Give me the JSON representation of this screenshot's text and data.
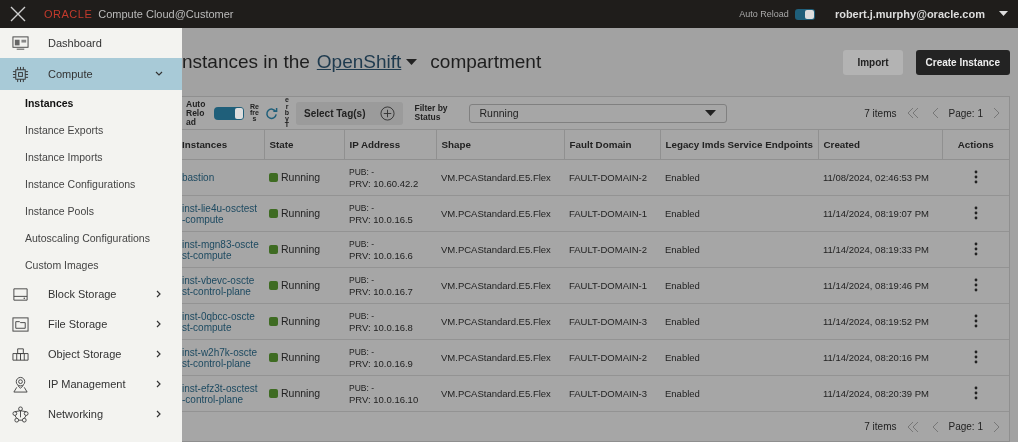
{
  "header": {
    "logo": "ORACLE",
    "product": "Compute Cloud@Customer",
    "auto_reload": {
      "label": "Auto Reload",
      "on": true
    },
    "user": "robert.j.murphy@oracle.com"
  },
  "sidebar": {
    "items": [
      {
        "kind": "link",
        "label": "Dashboard",
        "selected": false
      },
      {
        "kind": "group",
        "label": "Compute",
        "expanded": true,
        "selected": true,
        "children": [
          {
            "label": "Instances",
            "selected": true
          },
          {
            "label": "Instance Exports",
            "selected": false
          },
          {
            "label": "Instance Imports",
            "selected": false
          },
          {
            "label": "Instance Configurations",
            "selected": false
          },
          {
            "label": "Instance Pools",
            "selected": false
          },
          {
            "label": "Autoscaling Configurations",
            "selected": false
          },
          {
            "label": "Custom Images",
            "selected": false
          }
        ]
      },
      {
        "kind": "group",
        "label": "Block Storage",
        "expanded": false,
        "selected": false
      },
      {
        "kind": "group",
        "label": "File Storage",
        "expanded": false,
        "selected": false
      },
      {
        "kind": "group",
        "label": "Object Storage",
        "expanded": false,
        "selected": false
      },
      {
        "kind": "group",
        "label": "IP Management",
        "expanded": false,
        "selected": false
      },
      {
        "kind": "group",
        "label": "Networking",
        "expanded": false,
        "selected": false
      }
    ]
  },
  "page": {
    "title_start": "nstances in the",
    "compartment": "OpenShift",
    "title_end": "compartment",
    "buttons": [
      {
        "label": "Import",
        "kind": "secondary"
      },
      {
        "label": "Create Instance",
        "kind": "primary"
      }
    ]
  },
  "toolbar": {
    "auto_reload": {
      "label": "Auto Relo ad",
      "on": true
    },
    "refresh_label": "Refres",
    "tag_label": "erbyT",
    "select_tags": "Select Tag(s)",
    "filter_label": "Filter by Status",
    "filter_value": "Running"
  },
  "pager_top": {
    "count": "7 items",
    "page": "Page: 1"
  },
  "table": {
    "columns": [
      "Instances",
      "State",
      "IP Address",
      "Shape",
      "Fault Domain",
      "Legacy Imds Service Endpoints",
      "Created",
      "Actions"
    ],
    "rows": [
      {
        "name": "bastion",
        "state": {
          "label": "Running",
          "color": "#3e6b22"
        },
        "pub": "PUB: -",
        "prv": "PRV: 10.60.42.2",
        "shape": "VM.PCAStandard.E5.Flex",
        "fault_domain": "FAULT-DOMAIN-2",
        "legacy": "Enabled",
        "created": "11/08/2024, 02:46:53 PM"
      },
      {
        "name": "inst-lie4u-osctest-compute",
        "state": {
          "label": "Running",
          "color": "#3e6b22"
        },
        "pub": "PUB: -",
        "prv": "PRV: 10.0.16.5",
        "shape": "VM.PCAStandard.E5.Flex",
        "fault_domain": "FAULT-DOMAIN-1",
        "legacy": "Enabled",
        "created": "11/14/2024, 08:19:07 PM"
      },
      {
        "name": "inst-mgn83-osctest-compute",
        "state": {
          "label": "Running",
          "color": "#3e6b22"
        },
        "pub": "PUB: -",
        "prv": "PRV: 10.0.16.6",
        "shape": "VM.PCAStandard.E5.Flex",
        "fault_domain": "FAULT-DOMAIN-2",
        "legacy": "Enabled",
        "created": "11/14/2024, 08:19:33 PM"
      },
      {
        "name": "inst-vbevc-osctest-control-plane",
        "state": {
          "label": "Running",
          "color": "#3e6b22"
        },
        "pub": "PUB: -",
        "prv": "PRV: 10.0.16.7",
        "shape": "VM.PCAStandard.E5.Flex",
        "fault_domain": "FAULT-DOMAIN-1",
        "legacy": "Enabled",
        "created": "11/14/2024, 08:19:46 PM"
      },
      {
        "name": "inst-0qbcc-osctest-compute",
        "state": {
          "label": "Running",
          "color": "#3e6b22"
        },
        "pub": "PUB: -",
        "prv": "PRV: 10.0.16.8",
        "shape": "VM.PCAStandard.E5.Flex",
        "fault_domain": "FAULT-DOMAIN-3",
        "legacy": "Enabled",
        "created": "11/14/2024, 08:19:52 PM"
      },
      {
        "name": "inst-w2h7k-osctest-control-plane",
        "state": {
          "label": "Running",
          "color": "#3e6b22"
        },
        "pub": "PUB: -",
        "prv": "PRV: 10.0.16.9",
        "shape": "VM.PCAStandard.E5.Flex",
        "fault_domain": "FAULT-DOMAIN-2",
        "legacy": "Enabled",
        "created": "11/14/2024, 08:20:16 PM"
      },
      {
        "name": "inst-efz3t-osctest-control-plane",
        "state": {
          "label": "Running",
          "color": "#3e6b22"
        },
        "pub": "PUB: -",
        "prv": "PRV: 10.0.16.10",
        "shape": "VM.PCAStandard.E5.Flex",
        "fault_domain": "FAULT-DOMAIN-3",
        "legacy": "Enabled",
        "created": "11/14/2024, 08:20:39 PM"
      }
    ]
  },
  "pager_bottom": {
    "count": "7 items",
    "page": "Page: 1"
  }
}
